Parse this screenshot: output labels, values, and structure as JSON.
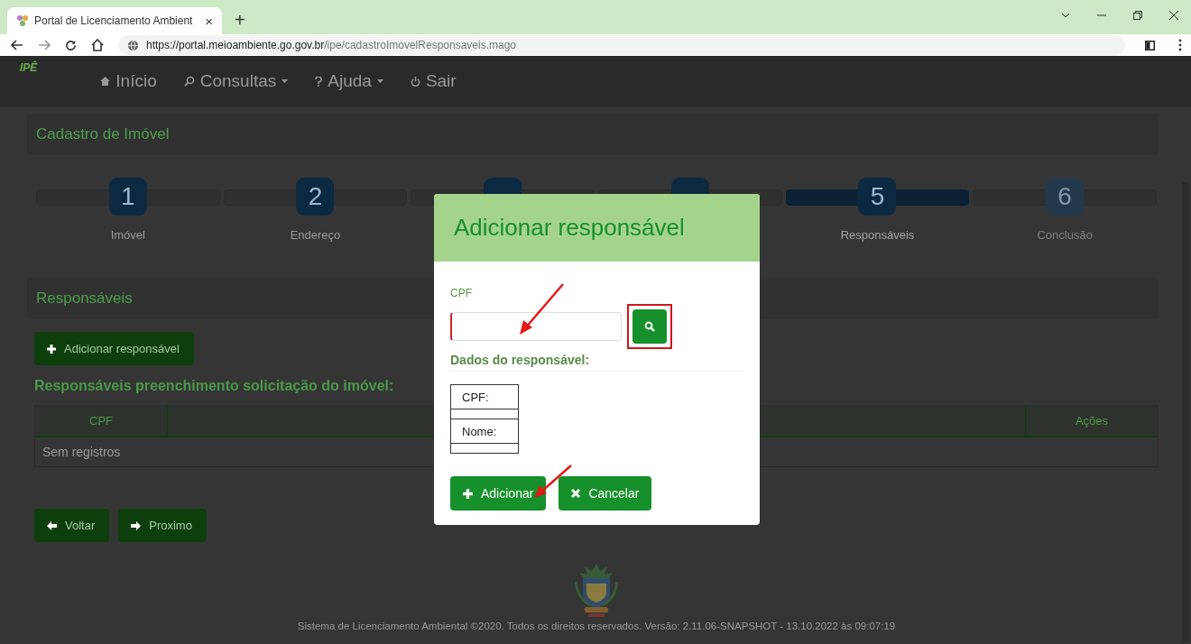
{
  "browser": {
    "tab_title": "Portal de Licenciamento Ambient",
    "tab_close": "×",
    "new_tab": "+",
    "url_host": "https://portal.meioambiente.go.gov.br",
    "url_path": "/ipe/cadastroImovelResponsaveis.mago"
  },
  "nav": {
    "logo": "IPÊ",
    "items": [
      {
        "label": "Início",
        "kind": "home",
        "dropdown": false
      },
      {
        "label": "Consultas",
        "kind": "search",
        "dropdown": true
      },
      {
        "label": "Ajuda",
        "kind": "help",
        "dropdown": true
      },
      {
        "label": "Sair",
        "kind": "logout",
        "dropdown": false
      }
    ]
  },
  "page_title": "Cadastro de Imóvel",
  "steps": [
    {
      "number": "1",
      "label": "Imóvel",
      "selected": false,
      "disabled": false
    },
    {
      "number": "2",
      "label": "Endereço",
      "selected": false,
      "disabled": false
    },
    {
      "selected": false,
      "disabled": false
    },
    {
      "selected": false,
      "disabled": false
    },
    {
      "number": "5",
      "label": "Responsáveis",
      "selected": true,
      "disabled": false
    },
    {
      "number": "6",
      "label": "Conclusão",
      "selected": false,
      "disabled": true
    }
  ],
  "section_title": "Responsáveis",
  "add_button": "Adicionar responsável",
  "table_caption": "Responsáveis preenchimento solicitação do imóvel:",
  "table": {
    "columns": [
      {
        "label": "CPF"
      },
      {
        "label": "Ações"
      }
    ],
    "empty_text": "Sem registros"
  },
  "back_button": "Voltar",
  "next_button": "Proximo",
  "footer": "Sistema de Licenciamento Ambiental ©2020. Todos os direitos reservados. Versão: 2.11.06-SNAPSHOT - 13.10.2022 às 09:07:19",
  "modal": {
    "title": "Adicionar responsável",
    "cpf_label": "CPF",
    "cpf_invalid": true,
    "search_highlighted": true,
    "details_title": "Dados do responsável:",
    "details_rows": [
      {
        "label": "CPF:"
      },
      {
        "label": "Nome:"
      }
    ],
    "add_button": "Adicionar",
    "cancel_button": "Cancelar"
  }
}
